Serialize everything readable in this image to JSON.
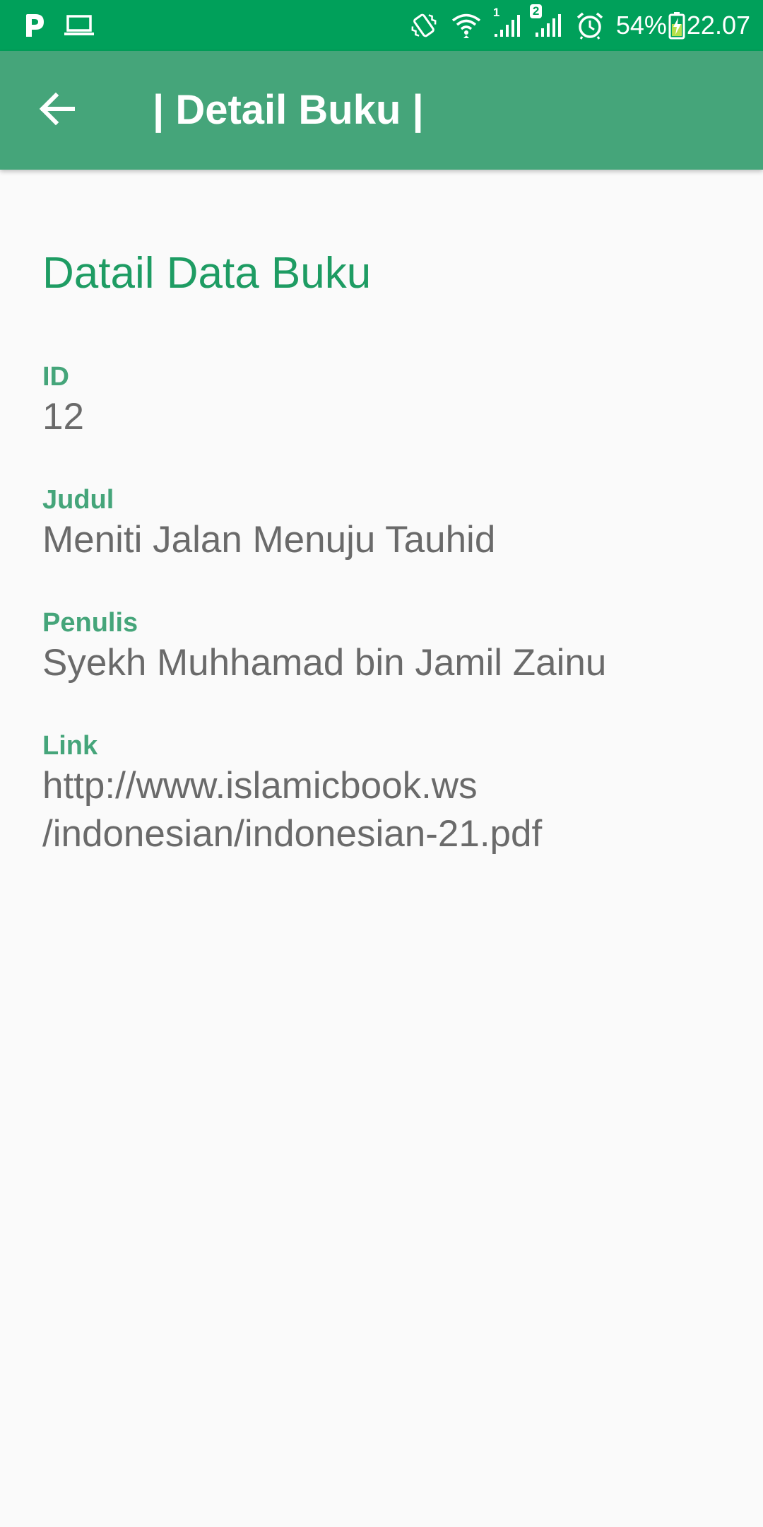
{
  "status_bar": {
    "battery_percent": "54%",
    "time": "22.07",
    "sim1_label": "1",
    "sim2_label": "2",
    "icons": [
      "p-app-icon",
      "laptop-icon",
      "vibrate-icon",
      "wifi-icon",
      "signal-sim1-icon",
      "signal-sim2-icon",
      "alarm-icon",
      "battery-charging-icon"
    ]
  },
  "app_bar": {
    "title": "| Detail Buku |",
    "back_icon": "arrow-back-icon",
    "color": "#45a57a"
  },
  "main": {
    "section_title": "Datail Data Buku",
    "fields": {
      "id": {
        "label": "ID",
        "value": "12"
      },
      "judul": {
        "label": "Judul",
        "value": "Meniti Jalan Menuju Tauhid"
      },
      "penulis": {
        "label": "Penulis",
        "value": "Syekh Muhhamad bin Jamil Zainu"
      },
      "link": {
        "label": "Link",
        "value_line1": "http://www.islamicbook.ws",
        "value_line2": "/indonesian/indonesian-21.pdf"
      }
    }
  },
  "colors": {
    "status_bar": "#00a05a",
    "accent": "#1e9c63",
    "label": "#45a57a",
    "value_text": "#6a6a6a",
    "background": "#fafafa"
  }
}
